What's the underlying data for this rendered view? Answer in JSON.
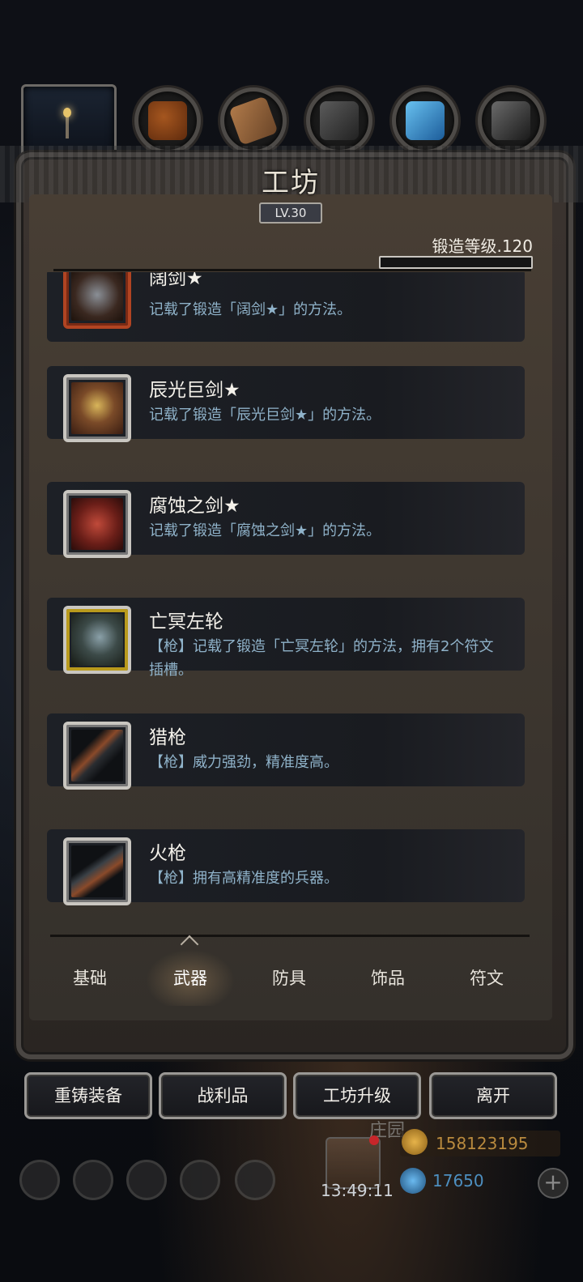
{
  "workshop": {
    "title": "工坊",
    "level": "LV.30",
    "forge_level_label": "锻造等级.120",
    "forge_progress": 0
  },
  "recipes": [
    {
      "name": "阔剑★",
      "desc": "记载了锻造「阔剑★」的方法。"
    },
    {
      "name": "辰光巨剑★",
      "desc": "记载了锻造「辰光巨剑★」的方法。"
    },
    {
      "name": "腐蚀之剑★",
      "desc": "记载了锻造「腐蚀之剑★」的方法。"
    },
    {
      "name": "亡冥左轮",
      "desc": "【枪】记载了锻造「亡冥左轮」的方法，拥有2个符文插槽。"
    },
    {
      "name": "猎枪",
      "desc": "【枪】威力强劲，精准度高。"
    },
    {
      "name": "火枪",
      "desc": "【枪】拥有高精准度的兵器。"
    }
  ],
  "categories": {
    "basic": "基础",
    "weapons": "武器",
    "armor": "防具",
    "accessories": "饰品",
    "runes": "符文",
    "active": "武器"
  },
  "actions": {
    "reforge": "重铸装备",
    "loot": "战利品",
    "upgrade": "工坊升级",
    "leave": "离开"
  },
  "hud": {
    "clock": "13:49:11",
    "gold": "158123195",
    "gems": "17650",
    "garden_label": "庄园"
  },
  "colors": {
    "accent_desc": "#8fb2c9",
    "gold": "#b98a3e",
    "gem": "#4d8fc0"
  }
}
